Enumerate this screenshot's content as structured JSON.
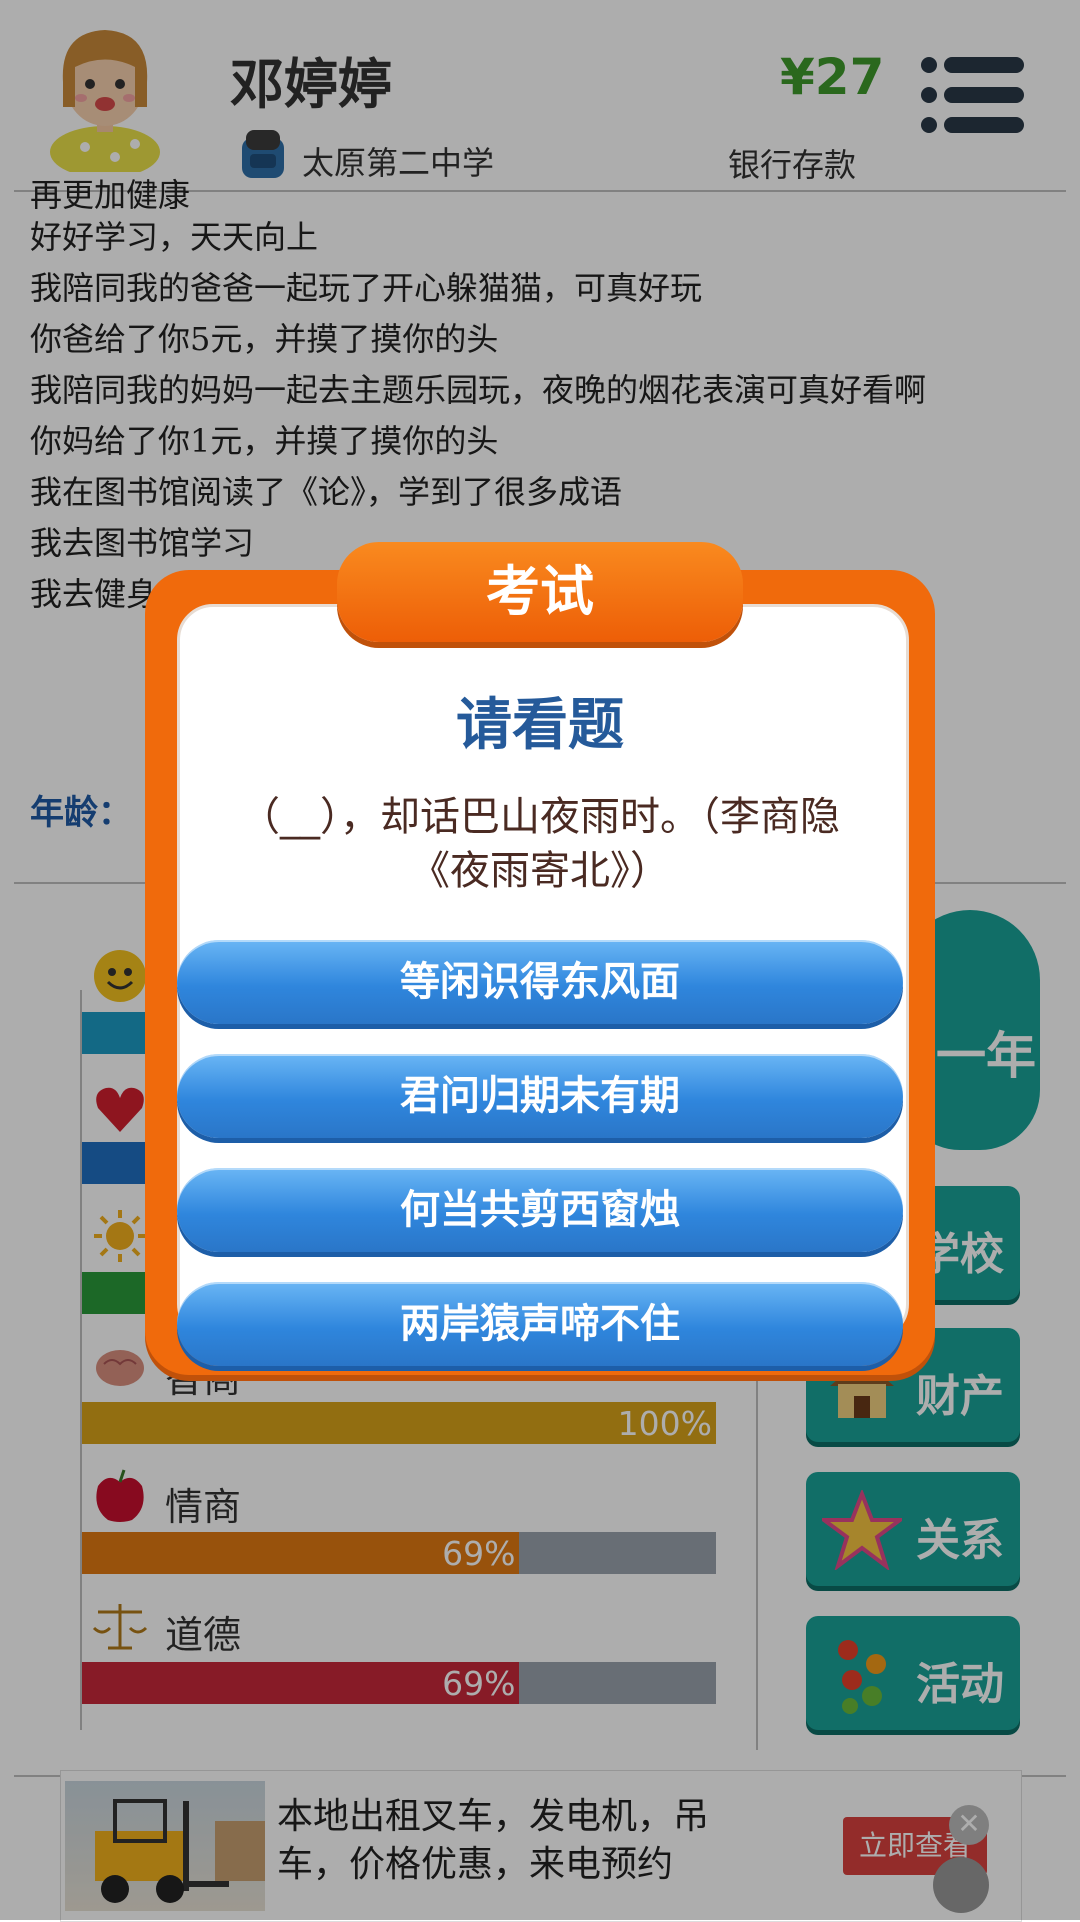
{
  "header": {
    "name": "邓婷婷",
    "school": "太原第二中学",
    "money": "¥27",
    "money_label": "银行存款"
  },
  "log": [
    "再更加健康",
    "好好学习，天天向上",
    "我陪同我的爸爸一起玩了开心躲猫猫，可真好玩",
    "你爸给了你5元，并摸了摸你的头",
    "我陪同我的妈妈一起去主题乐园玩，夜晚的烟花表演可真好看啊",
    "你妈给了你1元，并摸了摸你的头",
    "我在图书馆阅读了《论》，学到了很多成语",
    "我去图书馆学习",
    "我去健身房锻炼"
  ],
  "age_label": "年龄：",
  "stats": [
    {
      "label": "智商",
      "percent_text": "100%",
      "value": 1.0,
      "color": "#d8a31a"
    },
    {
      "label": "情商",
      "percent_text": "69%",
      "value": 0.69,
      "color": "#e07a12"
    },
    {
      "label": "道德",
      "percent_text": "69%",
      "value": 0.69,
      "color": "#c7283a"
    }
  ],
  "right_buttons": {
    "year": "一年",
    "school": "学校",
    "property": "财产",
    "relations": "关系",
    "activities": "活动"
  },
  "dialog": {
    "title": "考试",
    "heading": "请看题",
    "question": "（__），却话巴山夜雨时。（李商隐《夜雨寄北》）",
    "options": [
      "等闲识得东风面",
      "君问归期未有期",
      "何当共剪西窗烛",
      "两岸猿声啼不住"
    ]
  },
  "ad": {
    "text": "本地出租叉车，发电机，吊车，价格优惠，来电预约",
    "cta": "立即查看",
    "close": "✕"
  },
  "colors": {
    "accent_green": "#1aa398",
    "dialog_orange": "#f06a0c",
    "option_blue": "#2f86dd"
  }
}
